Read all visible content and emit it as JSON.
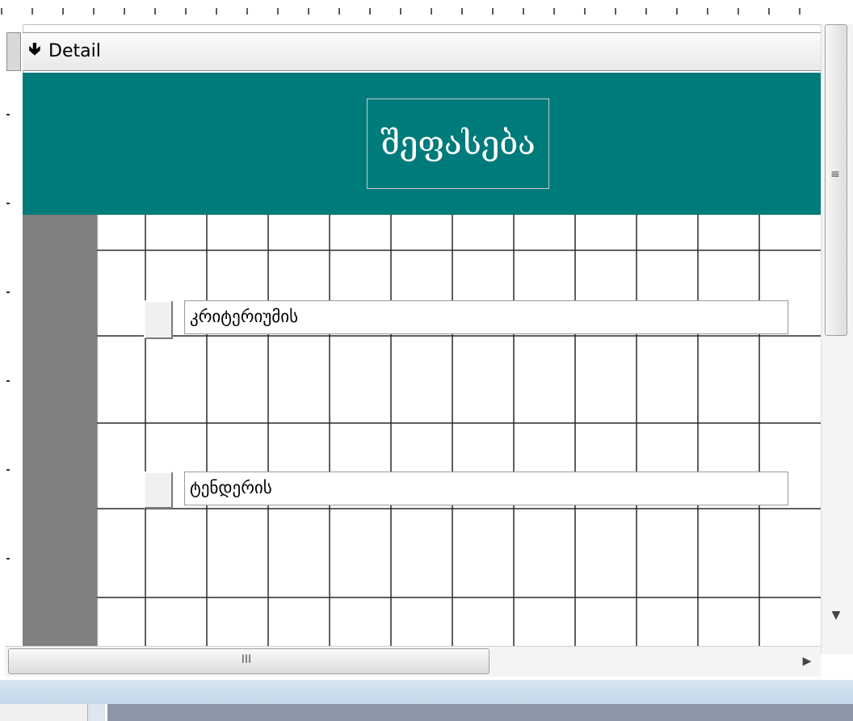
{
  "section": {
    "label": "Detail",
    "arrow_icon": "down-arrow-icon"
  },
  "form": {
    "title": "შეფასება",
    "header_color": "#007b7b",
    "rows": [
      {
        "label": "კრიტერიუმის"
      },
      {
        "label": "ტენდერის"
      }
    ]
  },
  "scrollbars": {
    "horizontal_grip": "III",
    "vertical_grip": "≡"
  },
  "colors": {
    "left_strip": "#808080",
    "grid_line": "#000000",
    "status_bar": "#c3d6e8"
  }
}
